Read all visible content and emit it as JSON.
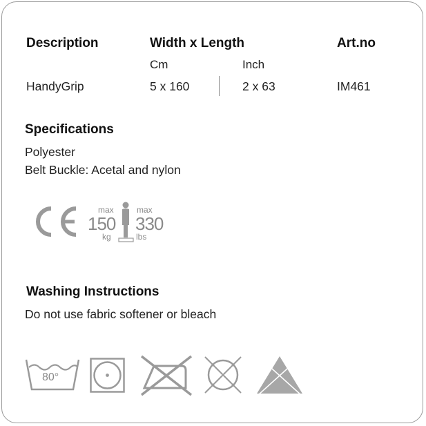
{
  "table": {
    "headers": {
      "description": "Description",
      "dimensions": "Width x Length",
      "art_no": "Art.no"
    },
    "units": {
      "cm": "Cm",
      "inch": "Inch"
    },
    "row": {
      "description": "HandyGrip",
      "cm": "5 x 160",
      "inch": "2 x 63",
      "art_no": "IM461"
    }
  },
  "specifications": {
    "title": "Specifications",
    "lines": [
      "Polyester",
      "Belt Buckle: Acetal and nylon"
    ]
  },
  "max_load": {
    "left_max": "max",
    "kg_value": "150",
    "kg_unit": "kg",
    "right_max": "max",
    "lbs_value": "330",
    "lbs_unit": "lbs"
  },
  "washing": {
    "title": "Washing Instructions",
    "text": "Do not use fabric softener or bleach",
    "symbol_temp": "80°",
    "icons": [
      "wash-80-icon",
      "tumble-dry-icon",
      "no-iron-icon",
      "no-dry-clean-icon",
      "no-bleach-icon"
    ]
  },
  "colors": {
    "symbol_grey": "#9a9a9a",
    "bleach_fill": "#a7a7a7",
    "border": "#9a9a9a"
  }
}
